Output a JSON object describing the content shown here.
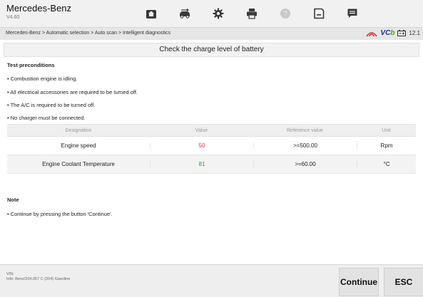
{
  "app": {
    "title": "Mercedes-Benz",
    "version": "V4.60"
  },
  "toolbar": {
    "buttons": [
      {
        "icon": "home-icon"
      },
      {
        "icon": "vehicle-swap-icon"
      },
      {
        "icon": "settings-icon"
      },
      {
        "icon": "print-icon"
      },
      {
        "icon": "help-icon"
      },
      {
        "icon": "save-icon"
      },
      {
        "icon": "message-icon"
      }
    ]
  },
  "breadcrumb": {
    "text": "Mercedes-Benz > Automatic selection > Auto scan > Intelligent diagnostics"
  },
  "status": {
    "vci_prefix": "VC",
    "vci_suffix": "b",
    "voltage": "12.1"
  },
  "page": {
    "title": "Check the charge level of battery",
    "preconditions_heading": "Test preconditions",
    "preconditions": [
      "• Combustion engine is idling.",
      "• All electrical accessories are required to be turned off.",
      "• The A/C is required to be turned off.",
      "• No charger must be connected."
    ],
    "table": {
      "headers": [
        "Designation",
        "Value",
        "Reference value",
        "Unit"
      ],
      "rows": [
        {
          "designation": "Engine speed",
          "value": "50",
          "reference": ">=500.00",
          "unit": "Rpm",
          "value_color": "#e03131"
        },
        {
          "designation": "Engine Coolant Temperature",
          "value": "81",
          "reference": ">=60.00",
          "unit": "°C",
          "value_color": "#2e9e3a"
        }
      ]
    },
    "note_heading": "Note",
    "notes": [
      "• Continue by pressing the button 'Continue'."
    ]
  },
  "footer": {
    "vin_label": "VIN:",
    "info": "Info: Benz/204.057 C (204) Gasoline",
    "continue_label": "Continue",
    "esc_label": "ESC"
  }
}
